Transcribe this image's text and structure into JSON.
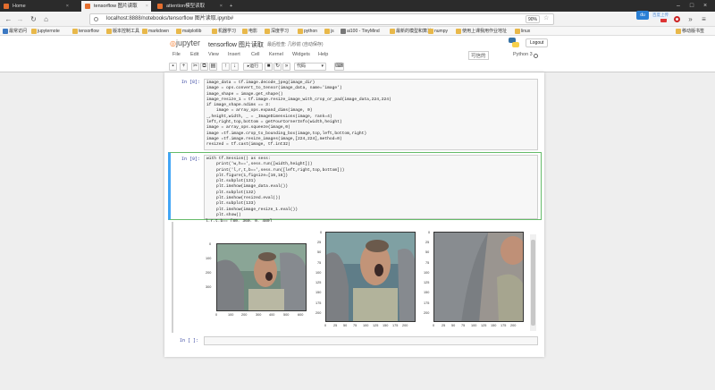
{
  "browser": {
    "tabs": [
      {
        "label": "Home",
        "active": false
      },
      {
        "label": "tensorflow 图片读取",
        "active": true
      },
      {
        "label": "attention模型读取",
        "active": false
      }
    ],
    "url": "localhost:8888/notebooks/tensorflow 图片读取.ipynb#",
    "zoom": "90%",
    "baidu_label": "百度上传",
    "bookmarks": [
      "最常访问",
      "jupyternote",
      "tensorflow",
      "版本控制工具",
      "markdown",
      "matplotlib",
      "机器学习",
      "电影",
      "深度学习",
      "python",
      "js",
      "ai100 - TinyMind",
      "最新的模型和算法",
      "numpy",
      "使用上课我用作业地址",
      "linux"
    ],
    "mobile_bookmarks": "移动版书签"
  },
  "jupyter": {
    "logo": "jupyter",
    "title": "tensorflow 图片读取",
    "checkpoint": "最后检查: 几秒前 (自动保存)",
    "logout": "Logout",
    "menu": [
      "File",
      "Edit",
      "View",
      "Insert",
      "Cell",
      "Kernel",
      "Widgets",
      "Help"
    ],
    "trusted": "可信的",
    "kernel": "Python 3",
    "run_label": "运行",
    "cell_type": "代码"
  },
  "cells": [
    {
      "prompt": "In [8]:",
      "lines": [
        "image_data = tf.image.decode_jpeg(image_dir)",
        "image = ops.convert_to_tensor(image_data, name='image')",
        "image_shape = image.get_shape()",
        "image_resize_1 = tf.image.resize_image_with_crop_or_pad(image_data,224,224)",
        "if image_shape.ndims == 3:",
        "    image = array_ops.expand_dims(image, 0)",
        "_,height,width, _ = _ImageDimensions(image, rank=4)",
        "left,right,top,bottom = getFourCornerInfo(width,height)",
        "image = array_ops.squeeze(image,0)",
        "image =tf.image.crop_to_bounding_box(image,top,left,bottom,right)",
        "image =tf.image.resize_images(image,[224,224],method=0)",
        "resized = tf.cast(image, tf.int32)"
      ]
    },
    {
      "prompt": "In [9]:",
      "lines": [
        "with tf.Session() as sess:",
        "    print('w,h==',sess.run([width,height]))",
        "    print('l,r,t,b==',sess.run([left,right,top,bottom]))",
        "    plt.figure(1,figsize=[16,16])",
        "    plt.subplot(131)",
        "    plt.imshow(image_data.eval())",
        "    plt.subplot(132)",
        "    plt.imshow(resized.eval())",
        "    plt.subplot(133)",
        "    plt.imshow(image_resize_1.eval())",
        "    plt.show()"
      ],
      "output_text": "l,r,t,b== [80, 360, 0, 480]"
    },
    {
      "prompt": "In [ ]:",
      "lines": [
        ""
      ]
    }
  ],
  "plots": [
    {
      "yticks": [
        "0",
        "100",
        "200",
        "300"
      ],
      "xticks": [
        "0",
        "100",
        "200",
        "300",
        "400",
        "500",
        "600"
      ]
    },
    {
      "yticks": [
        "0",
        "25",
        "50",
        "75",
        "100",
        "125",
        "150",
        "175",
        "200"
      ],
      "xticks": [
        "0",
        "25",
        "50",
        "75",
        "100",
        "125",
        "150",
        "175",
        "200"
      ]
    },
    {
      "yticks": [
        "0",
        "25",
        "50",
        "75",
        "100",
        "125",
        "150",
        "175",
        "200"
      ],
      "xticks": [
        "0",
        "25",
        "50",
        "75",
        "100",
        "125",
        "150",
        "175",
        "200"
      ]
    }
  ]
}
